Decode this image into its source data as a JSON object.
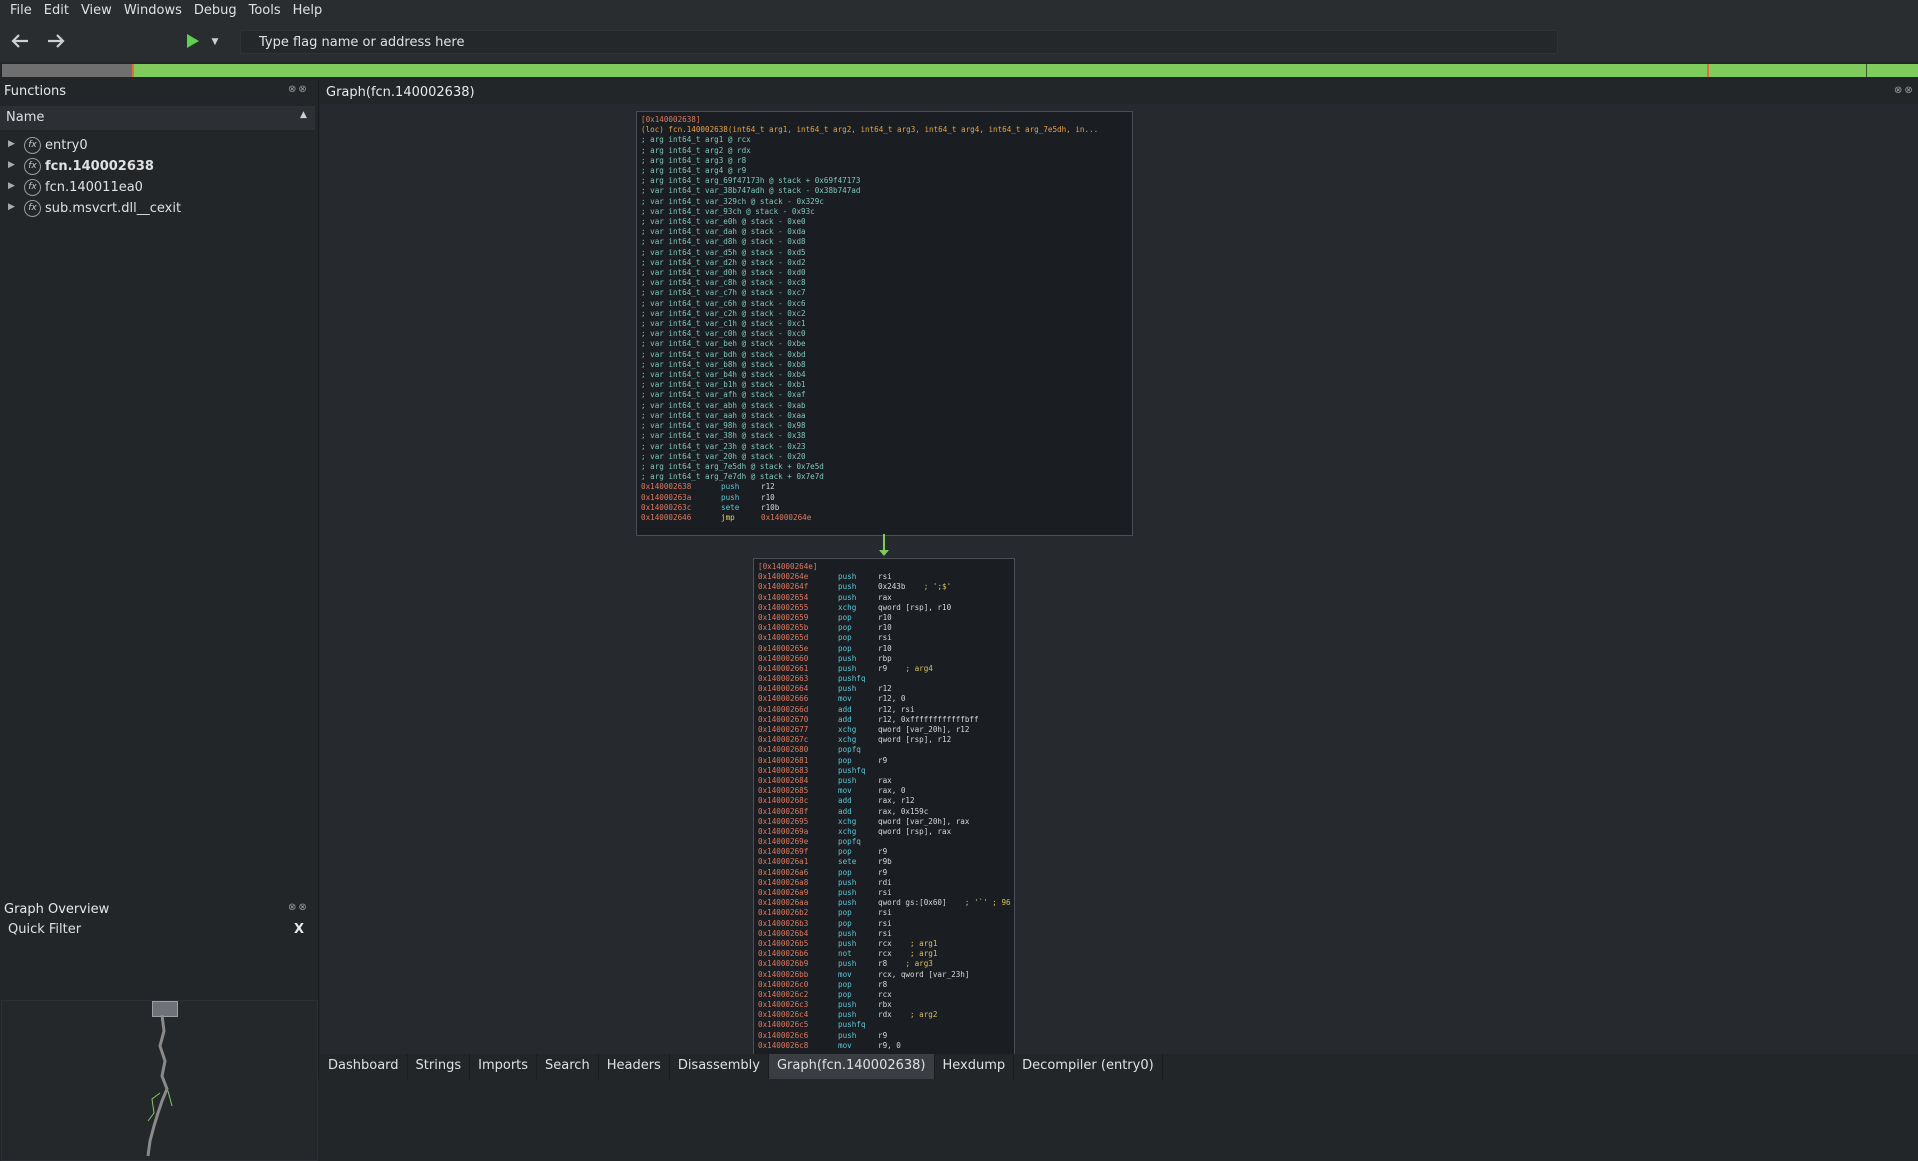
{
  "menu": [
    "File",
    "Edit",
    "View",
    "Windows",
    "Debug",
    "Tools",
    "Help"
  ],
  "toolbar": {
    "search_placeholder": "Type flag name or address here"
  },
  "functions_panel": {
    "title": "Functions",
    "column": "Name",
    "items": [
      {
        "label": "entry0",
        "bold": false
      },
      {
        "label": "fcn.140002638",
        "bold": true
      },
      {
        "label": "fcn.140011ea0",
        "bold": false
      },
      {
        "label": "sub.msvcrt.dll__cexit",
        "bold": false
      }
    ]
  },
  "quick_filter": {
    "label": "Quick Filter",
    "close": "X"
  },
  "graph_overview": {
    "title": "Graph Overview"
  },
  "graph": {
    "title": "Graph(fcn.140002638)",
    "block1": {
      "header": "[0x140002638]",
      "signature": "(loc) fcn.140002638(int64_t arg1, int64_t arg2, int64_t arg3, int64_t arg4, int64_t arg_7e5dh, in...",
      "comments": [
        "; arg int64_t arg1 @ rcx",
        "; arg int64_t arg2 @ rdx",
        "; arg int64_t arg3 @ r8",
        "; arg int64_t arg4 @ r9",
        "; arg int64_t arg_69f47173h @ stack + 0x69f47173",
        "; var int64_t var_38b747adh @ stack - 0x38b747ad",
        "; var int64_t var_329ch @ stack - 0x329c",
        "; var int64_t var_93ch @ stack - 0x93c",
        "; var int64_t var_e0h @ stack - 0xe0",
        "; var int64_t var_dah @ stack - 0xda",
        "; var int64_t var_d8h @ stack - 0xd8",
        "; var int64_t var_d5h @ stack - 0xd5",
        "; var int64_t var_d2h @ stack - 0xd2",
        "; var int64_t var_d0h @ stack - 0xd0",
        "; var int64_t var_c8h @ stack - 0xc8",
        "; var int64_t var_c7h @ stack - 0xc7",
        "; var int64_t var_c6h @ stack - 0xc6",
        "; var int64_t var_c2h @ stack - 0xc2",
        "; var int64_t var_c1h @ stack - 0xc1",
        "; var int64_t var_c0h @ stack - 0xc0",
        "; var int64_t var_beh @ stack - 0xbe",
        "; var int64_t var_bdh @ stack - 0xbd",
        "; var int64_t var_b8h @ stack - 0xb8",
        "; var int64_t var_b4h @ stack - 0xb4",
        "; var int64_t var_b1h @ stack - 0xb1",
        "; var int64_t var_afh @ stack - 0xaf",
        "; var int64_t var_abh @ stack - 0xab",
        "; var int64_t var_aah @ stack - 0xaa",
        "; var int64_t var_98h @ stack - 0x98",
        "; var int64_t var_38h @ stack - 0x38",
        "; var int64_t var_23h @ stack - 0x23",
        "; var int64_t var_20h @ stack - 0x20",
        "; arg int64_t arg_7e5dh @ stack + 0x7e5d",
        "; arg int64_t arg_7e7dh @ stack + 0x7e7d"
      ],
      "instructions": [
        {
          "addr": "0x140002638",
          "mn": "push",
          "op": "r12"
        },
        {
          "addr": "0x14000263a",
          "mn": "push",
          "op": "r10"
        },
        {
          "addr": "0x14000263c",
          "mn": "sete",
          "op": "r10b"
        },
        {
          "addr": "0x140002646",
          "mn": "jmp",
          "op": "0x14000264e",
          "jump": true
        }
      ]
    },
    "block2": {
      "header": "[0x14000264e]",
      "instructions": [
        {
          "addr": "0x14000264e",
          "mn": "push",
          "op": "rsi"
        },
        {
          "addr": "0x14000264f",
          "mn": "push",
          "op": "0x243b",
          "comment": "; ';$'"
        },
        {
          "addr": "0x140002654",
          "mn": "push",
          "op": "rax"
        },
        {
          "addr": "0x140002655",
          "mn": "xchg",
          "op": "qword [rsp], r10"
        },
        {
          "addr": "0x140002659",
          "mn": "pop",
          "op": "r10"
        },
        {
          "addr": "0x14000265b",
          "mn": "pop",
          "op": "r10"
        },
        {
          "addr": "0x14000265d",
          "mn": "pop",
          "op": "rsi"
        },
        {
          "addr": "0x14000265e",
          "mn": "pop",
          "op": "r10"
        },
        {
          "addr": "0x140002660",
          "mn": "push",
          "op": "rbp"
        },
        {
          "addr": "0x140002661",
          "mn": "push",
          "op": "r9",
          "comment": "; arg4"
        },
        {
          "addr": "0x140002663",
          "mn": "pushfq",
          "op": ""
        },
        {
          "addr": "0x140002664",
          "mn": "push",
          "op": "r12"
        },
        {
          "addr": "0x140002666",
          "mn": "mov",
          "op": "r12, 0"
        },
        {
          "addr": "0x14000266d",
          "mn": "add",
          "op": "r12, rsi"
        },
        {
          "addr": "0x140002670",
          "mn": "add",
          "op": "r12, 0xffffffffffffbff"
        },
        {
          "addr": "0x140002677",
          "mn": "xchg",
          "op": "qword [var_20h], r12"
        },
        {
          "addr": "0x14000267c",
          "mn": "xchg",
          "op": "qword [rsp], r12"
        },
        {
          "addr": "0x140002680",
          "mn": "popfq",
          "op": ""
        },
        {
          "addr": "0x140002681",
          "mn": "pop",
          "op": "r9"
        },
        {
          "addr": "0x140002683",
          "mn": "pushfq",
          "op": ""
        },
        {
          "addr": "0x140002684",
          "mn": "push",
          "op": "rax"
        },
        {
          "addr": "0x140002685",
          "mn": "mov",
          "op": "rax, 0"
        },
        {
          "addr": "0x14000268c",
          "mn": "add",
          "op": "rax, r12"
        },
        {
          "addr": "0x14000268f",
          "mn": "add",
          "op": "rax, 0x159c"
        },
        {
          "addr": "0x140002695",
          "mn": "xchg",
          "op": "qword [var_20h], rax"
        },
        {
          "addr": "0x14000269a",
          "mn": "xchg",
          "op": "qword [rsp], rax"
        },
        {
          "addr": "0x14000269e",
          "mn": "popfq",
          "op": ""
        },
        {
          "addr": "0x14000269f",
          "mn": "pop",
          "op": "r9"
        },
        {
          "addr": "0x1400026a1",
          "mn": "sete",
          "op": "r9b"
        },
        {
          "addr": "0x1400026a6",
          "mn": "pop",
          "op": "r9"
        },
        {
          "addr": "0x1400026a8",
          "mn": "push",
          "op": "rdi"
        },
        {
          "addr": "0x1400026a9",
          "mn": "push",
          "op": "rsi"
        },
        {
          "addr": "0x1400026aa",
          "mn": "push",
          "op": "qword gs:[0x60]",
          "comment": "; '`' ; 96"
        },
        {
          "addr": "0x1400026b2",
          "mn": "pop",
          "op": "rsi"
        },
        {
          "addr": "0x1400026b3",
          "mn": "pop",
          "op": "rsi"
        },
        {
          "addr": "0x1400026b4",
          "mn": "push",
          "op": "rsi"
        },
        {
          "addr": "0x1400026b5",
          "mn": "push",
          "op": "rcx",
          "comment": "; arg1"
        },
        {
          "addr": "0x1400026b6",
          "mn": "not",
          "op": "rcx",
          "comment": "; arg1"
        },
        {
          "addr": "0x1400026b9",
          "mn": "push",
          "op": "r8",
          "comment": "; arg3"
        },
        {
          "addr": "0x1400026bb",
          "mn": "mov",
          "op": "rcx, qword [var_23h]"
        },
        {
          "addr": "0x1400026c0",
          "mn": "pop",
          "op": "r8"
        },
        {
          "addr": "0x1400026c2",
          "mn": "pop",
          "op": "rcx"
        },
        {
          "addr": "0x1400026c3",
          "mn": "push",
          "op": "rbx"
        },
        {
          "addr": "0x1400026c4",
          "mn": "push",
          "op": "rdx",
          "comment": "; arg2"
        },
        {
          "addr": "0x1400026c5",
          "mn": "pushfq",
          "op": ""
        },
        {
          "addr": "0x1400026c6",
          "mn": "push",
          "op": "r9"
        },
        {
          "addr": "0x1400026c8",
          "mn": "mov",
          "op": "r9, 0"
        }
      ]
    }
  },
  "tabs": [
    "Dashboard",
    "Strings",
    "Imports",
    "Search",
    "Headers",
    "Disassembly",
    "Graph(fcn.140002638)",
    "Hexdump",
    "Decompiler (entry0)"
  ],
  "active_tab": "Graph(fcn.140002638)"
}
